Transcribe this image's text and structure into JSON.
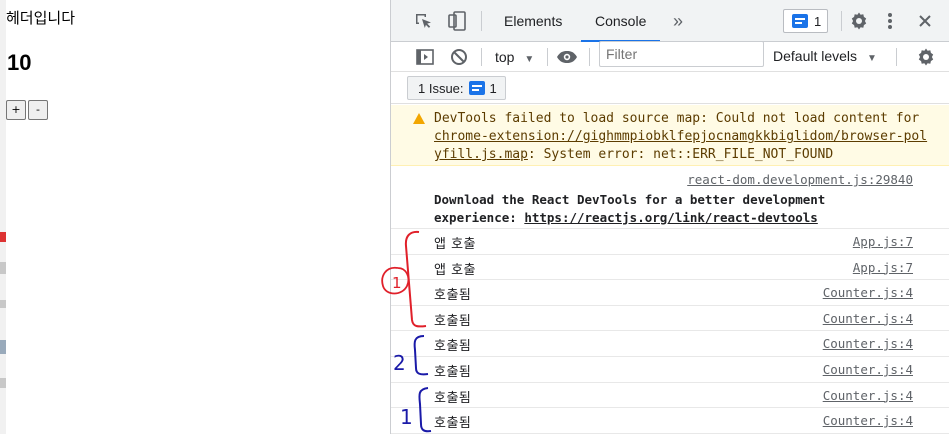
{
  "page": {
    "header": "헤더입니다",
    "count": "10",
    "increment_label": "+",
    "decrement_label": "-"
  },
  "devtools": {
    "tabs": [
      {
        "label": "Elements",
        "active": false
      },
      {
        "label": "Console",
        "active": true
      }
    ],
    "more_tabs_glyph": "»",
    "issue_badge_count": "1",
    "context": "top",
    "filter_placeholder": "Filter",
    "levels": "Default levels",
    "issues_bar_label": "1 Issue:",
    "issues_bar_count": "1"
  },
  "console": {
    "warning": {
      "prefix": "DevTools failed to load source map: Could not load content for ",
      "link": "chrome-extension://gighmmpiobklfepjocnamgkkbiglidom/browser-polyfill.js.map",
      "suffix": ": System error: net::ERR_FILE_NOT_FOUND"
    },
    "react_notice": {
      "source": "react-dom.development.js:29840",
      "text": "Download the React DevTools for a better development experience: ",
      "link": "https://reactjs.org/link/react-devtools"
    },
    "logs": [
      {
        "message": "앱 호출",
        "source": "App.js:7"
      },
      {
        "message": "앱 호출",
        "source": "App.js:7"
      },
      {
        "message": "호출됨",
        "source": "Counter.js:4"
      },
      {
        "message": "호출됨",
        "source": "Counter.js:4"
      },
      {
        "message": "호출됨",
        "source": "Counter.js:4"
      },
      {
        "message": "호출됨",
        "source": "Counter.js:4"
      },
      {
        "message": "호출됨",
        "source": "Counter.js:4"
      },
      {
        "message": "호출됨",
        "source": "Counter.js:4"
      }
    ]
  },
  "annotations": {
    "labels": [
      "1",
      "2",
      "1"
    ],
    "colors": {
      "group1": "#e0202a",
      "group2": "#1a1aa8",
      "group3": "#1a1aa8"
    }
  },
  "colors": {
    "accent": "#1a73e8",
    "warning_bg": "#fffbe5",
    "warning_icon": "#f2a600",
    "toolbar_bg": "#f1f3f4"
  }
}
